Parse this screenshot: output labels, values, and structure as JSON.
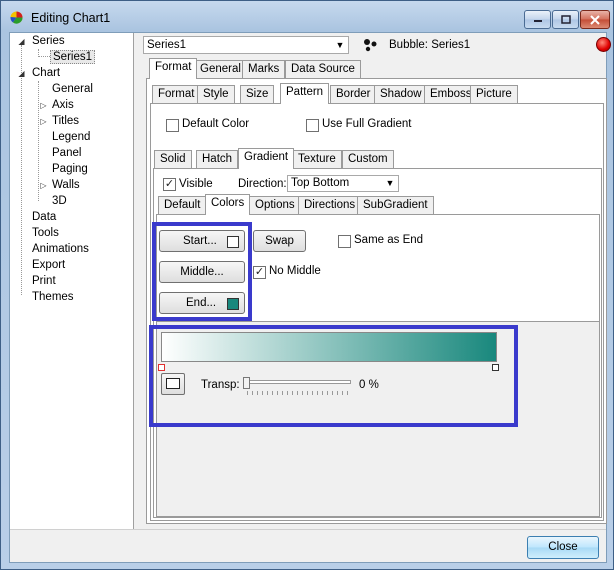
{
  "window": {
    "title": "Editing Chart1"
  },
  "tree": {
    "series": "Series",
    "series1": "Series1",
    "chart": "Chart",
    "general": "General",
    "axis": "Axis",
    "titles": "Titles",
    "legend": "Legend",
    "panel": "Panel",
    "paging": "Paging",
    "walls": "Walls",
    "three_d": "3D",
    "data": "Data",
    "tools": "Tools",
    "animations": "Animations",
    "export": "Export",
    "print": "Print",
    "themes": "Themes"
  },
  "series_select": {
    "value": "Series1",
    "bubble_label": "Bubble: Series1"
  },
  "tabs_top": [
    "Format",
    "General",
    "Marks",
    "Data Source"
  ],
  "tabs_format": [
    "Format",
    "Style",
    "Size",
    "Pattern",
    "Border",
    "Shadow",
    "Emboss",
    "Picture"
  ],
  "pattern": {
    "default_color": "Default Color",
    "use_full_gradient": "Use Full Gradient"
  },
  "tabs_pattern": [
    "Solid",
    "Hatch",
    "Gradient",
    "Texture",
    "Custom"
  ],
  "gradient": {
    "visible": "Visible",
    "direction_label": "Direction:",
    "direction_value": "Top Bottom"
  },
  "tabs_gradient": [
    "Default",
    "Colors",
    "Options",
    "Directions",
    "SubGradient"
  ],
  "colors": {
    "start": "Start...",
    "middle": "Middle...",
    "end": "End...",
    "swap": "Swap",
    "same_as_end": "Same as End",
    "no_middle": "No Middle",
    "start_color": "#ffffff",
    "end_color": "#19887d"
  },
  "transparency": {
    "label": "Transp:",
    "value": "0 %"
  },
  "footer": {
    "close": "Close"
  }
}
